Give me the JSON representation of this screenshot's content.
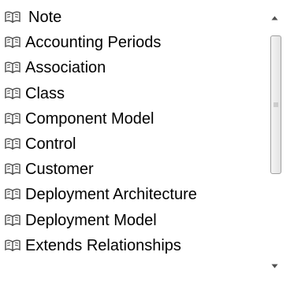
{
  "list": {
    "icon": "open-book-icon",
    "items": [
      {
        "label": "Note"
      },
      {
        "label": "Accounting Periods"
      },
      {
        "label": "Association"
      },
      {
        "label": "Class"
      },
      {
        "label": "Component Model"
      },
      {
        "label": "Control"
      },
      {
        "label": "Customer"
      },
      {
        "label": "Deployment Architecture"
      },
      {
        "label": "Deployment Model"
      },
      {
        "label": "Extends Relationships"
      }
    ]
  },
  "scrollbar": {
    "position_fraction": 0.0,
    "visible_fraction": 0.55
  },
  "colors": {
    "icon_stroke": "#4a4a4a",
    "text": "#000000",
    "thumb_border": "#a0a0a0"
  }
}
